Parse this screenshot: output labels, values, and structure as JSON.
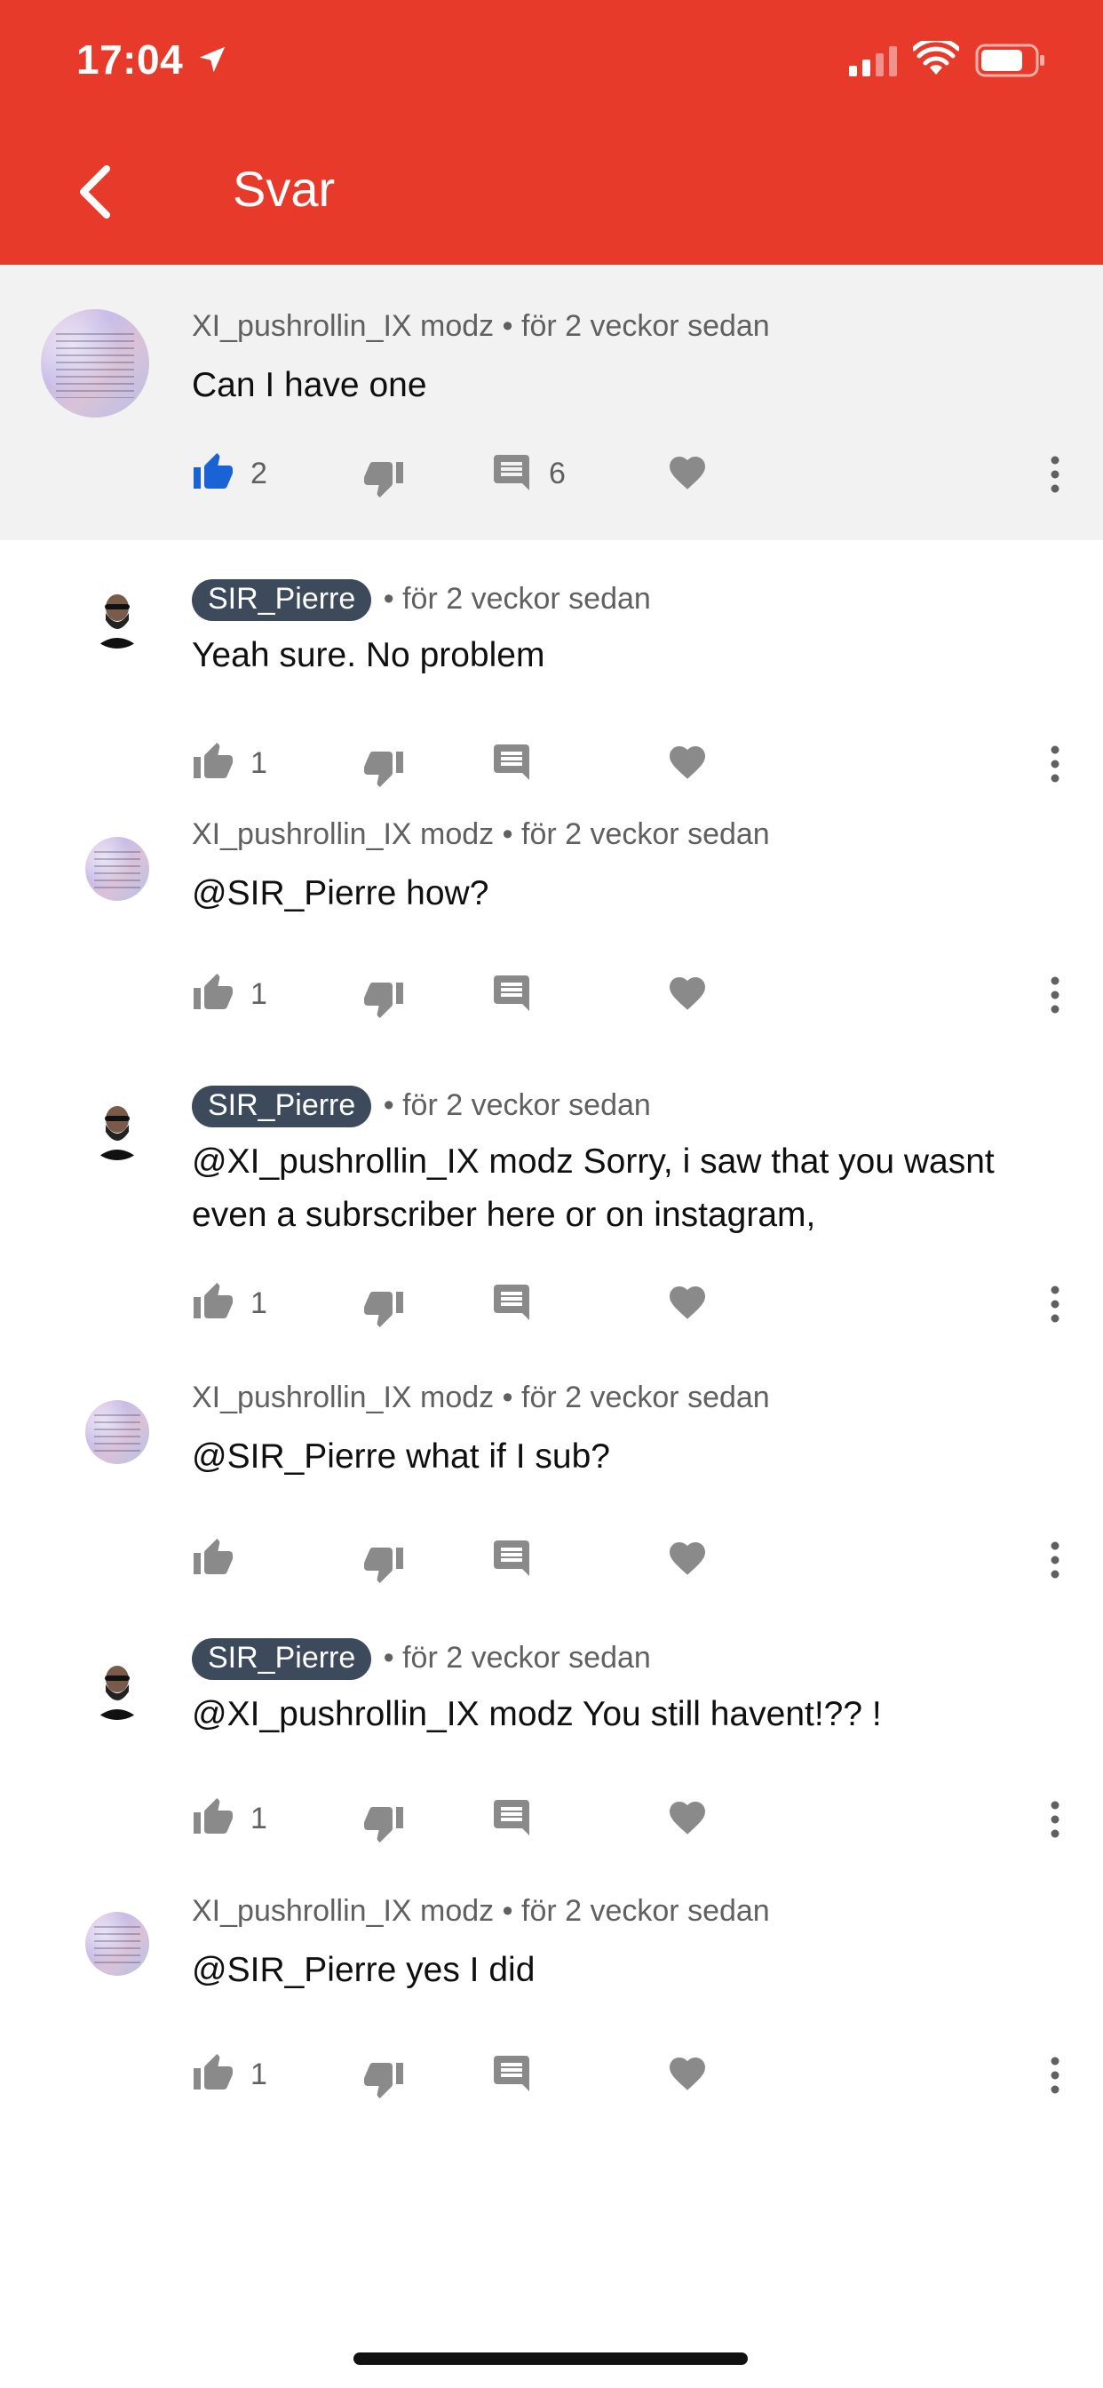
{
  "status_bar": {
    "time": "17:04"
  },
  "header": {
    "title": "Svar",
    "bg_color": "#e83a2a"
  },
  "comments": [
    {
      "author": "XI_pushrollin_IX modz",
      "time": "för 2 veckor sedan",
      "text": "Can I have one",
      "likes": "2",
      "replies": "6",
      "liked": true,
      "is_creator": false,
      "avatar": "xi-avatar"
    },
    {
      "author": "SIR_Pierre",
      "time": "för 2 veckor sedan",
      "text": "Yeah sure. No problem",
      "likes": "1",
      "is_creator": true,
      "avatar": "sir-avatar"
    },
    {
      "author": "XI_pushrollin_IX modz",
      "time": "för 2 veckor sedan",
      "text": "@SIR_Pierre  how?",
      "likes": "1",
      "is_creator": false,
      "avatar": "xi-avatar"
    },
    {
      "author": "SIR_Pierre",
      "time": "för 2 veckor sedan",
      "text_lines": [
        "@XI_pushrollin_IX modz Sorry, i saw that you wasnt",
        "even a subrscriber here or on instagram,"
      ],
      "likes": "1",
      "is_creator": true,
      "avatar": "sir-avatar"
    },
    {
      "author": "XI_pushrollin_IX modz",
      "time": "för 2 veckor sedan",
      "text": "@SIR_Pierre  what if I sub?",
      "likes": "",
      "is_creator": false,
      "avatar": "xi-avatar"
    },
    {
      "author": "SIR_Pierre",
      "time": "för 2 veckor sedan",
      "text": "@XI_pushrollin_IX modz You still havent!?? !",
      "likes": "1",
      "is_creator": true,
      "avatar": "sir-avatar"
    },
    {
      "author": "XI_pushrollin_IX modz",
      "time": "för 2 veckor sedan",
      "text": "@SIR_Pierre  yes I did",
      "likes": "1",
      "is_creator": false,
      "avatar": "xi-avatar"
    }
  ],
  "icons": {
    "like": "thumbs-up-icon",
    "dislike": "thumbs-down-icon",
    "reply": "comment-icon",
    "heart": "heart-icon",
    "more": "more-vertical-icon"
  },
  "colors": {
    "liked_blue": "#1a63d6",
    "icon_gray": "#8a8a8a",
    "creator_chip": "#3c4a5c"
  }
}
